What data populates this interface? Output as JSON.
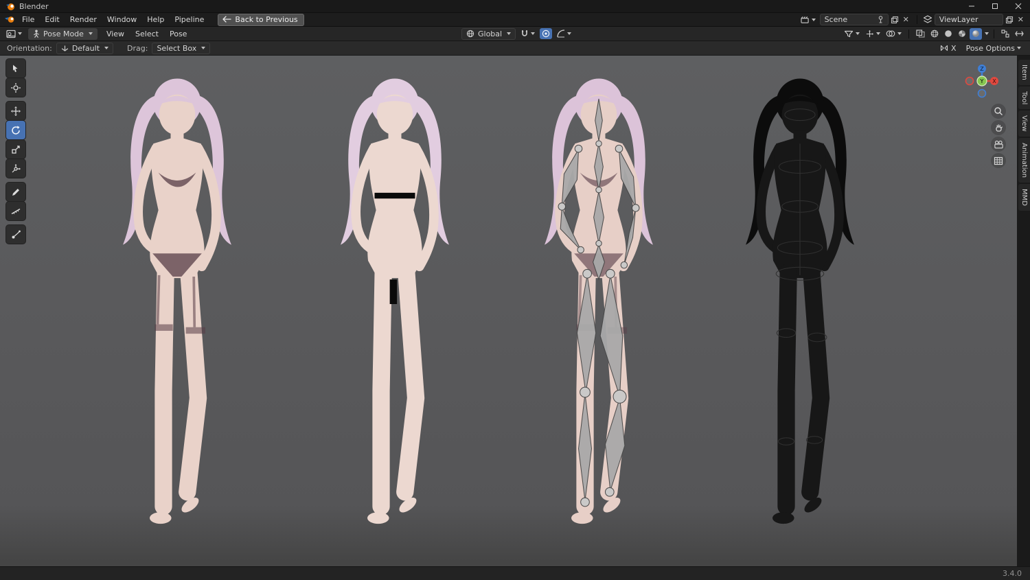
{
  "window": {
    "title": "Blender"
  },
  "titlebar": {
    "controls": {
      "minimize": "minimize",
      "maximize": "maximize",
      "close": "close"
    }
  },
  "menubar": {
    "menus": [
      "File",
      "Edit",
      "Render",
      "Window",
      "Help",
      "Pipeline"
    ],
    "back_button": "Back to Previous",
    "scene": {
      "label": "Scene"
    },
    "view_layer": {
      "label": "ViewLayer"
    }
  },
  "viewport_header": {
    "mode": "Pose Mode",
    "menus": [
      "View",
      "Select",
      "Pose"
    ],
    "orientation": "Global"
  },
  "tool_settings": {
    "orientation_label": "Orientation:",
    "orientation_value": "Default",
    "drag_label": "Drag:",
    "drag_value": "Select Box",
    "mirror_label": "X",
    "pose_options_label": "Pose Options"
  },
  "toolbar": {
    "tools": [
      "Select Box",
      "Cursor",
      "Move",
      "Rotate",
      "Scale",
      "Transform",
      "Annotate",
      "Measure",
      "Pose Breakdowner"
    ],
    "active_tool": "Rotate"
  },
  "nav_gizmo": {
    "x": "X",
    "y": "Y",
    "z": "Z"
  },
  "sidebar_tabs": [
    "Item",
    "Tool",
    "View",
    "Animation",
    "MMD"
  ],
  "viewport": {
    "models": [
      "character model (textured)",
      "character model (base mesh)",
      "character model (armature overlay)",
      "character model (wireframe)"
    ]
  },
  "status_bar": {
    "version": "3.4.0"
  },
  "icons": {
    "close": "✕"
  },
  "colors": {
    "accent": "#4772b3",
    "viewport_bg": "#59595b",
    "axis_x": "#e0493f",
    "axis_y": "#87c750",
    "axis_z": "#3f7fd6"
  }
}
